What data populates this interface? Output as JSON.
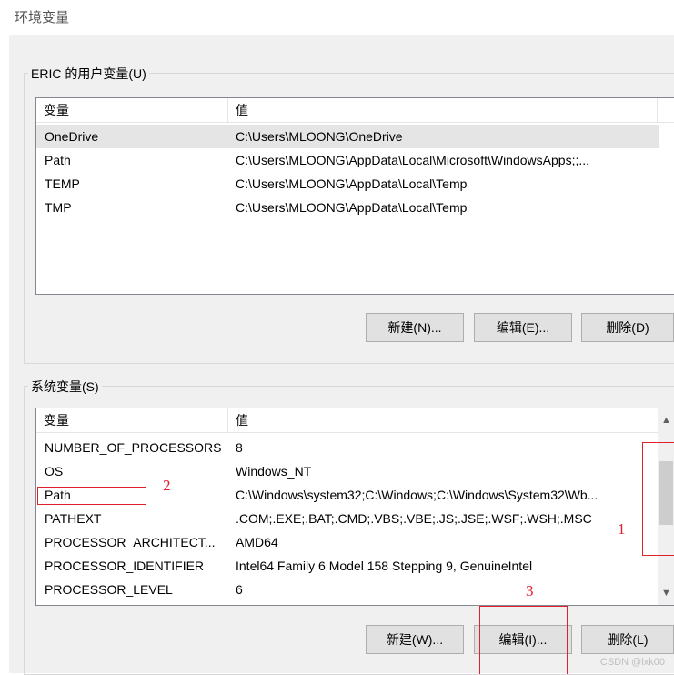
{
  "window": {
    "title": "环境变量"
  },
  "user_vars": {
    "group_label": "ERIC 的用户变量(U)",
    "columns": [
      "变量",
      "值"
    ],
    "rows": [
      {
        "name": "OneDrive",
        "value": "C:\\Users\\MLOONG\\OneDrive"
      },
      {
        "name": "Path",
        "value": "C:\\Users\\MLOONG\\AppData\\Local\\Microsoft\\WindowsApps;;..."
      },
      {
        "name": "TEMP",
        "value": "C:\\Users\\MLOONG\\AppData\\Local\\Temp"
      },
      {
        "name": "TMP",
        "value": "C:\\Users\\MLOONG\\AppData\\Local\\Temp"
      }
    ],
    "buttons": {
      "new": "新建(N)...",
      "edit": "编辑(E)...",
      "delete": "删除(D)"
    }
  },
  "system_vars": {
    "group_label": "系统变量(S)",
    "columns": [
      "变量",
      "值"
    ],
    "rows": [
      {
        "name": "NUMBER_OF_PROCESSORS",
        "value": "8"
      },
      {
        "name": "OS",
        "value": "Windows_NT"
      },
      {
        "name": "Path",
        "value": "C:\\Windows\\system32;C:\\Windows;C:\\Windows\\System32\\Wb..."
      },
      {
        "name": "PATHEXT",
        "value": ".COM;.EXE;.BAT;.CMD;.VBS;.VBE;.JS;.JSE;.WSF;.WSH;.MSC"
      },
      {
        "name": "PROCESSOR_ARCHITECT...",
        "value": "AMD64"
      },
      {
        "name": "PROCESSOR_IDENTIFIER",
        "value": "Intel64 Family 6 Model 158 Stepping 9, GenuineIntel"
      },
      {
        "name": "PROCESSOR_LEVEL",
        "value": "6"
      }
    ],
    "buttons": {
      "new": "新建(W)...",
      "edit": "编辑(I)...",
      "delete": "删除(L)"
    }
  },
  "annotations": {
    "one": "1",
    "two": "2",
    "three": "3"
  },
  "watermark": "CSDN @lxk00",
  "colors": {
    "annotation_red": "#e0202a",
    "selection": "#e5e5e5"
  }
}
